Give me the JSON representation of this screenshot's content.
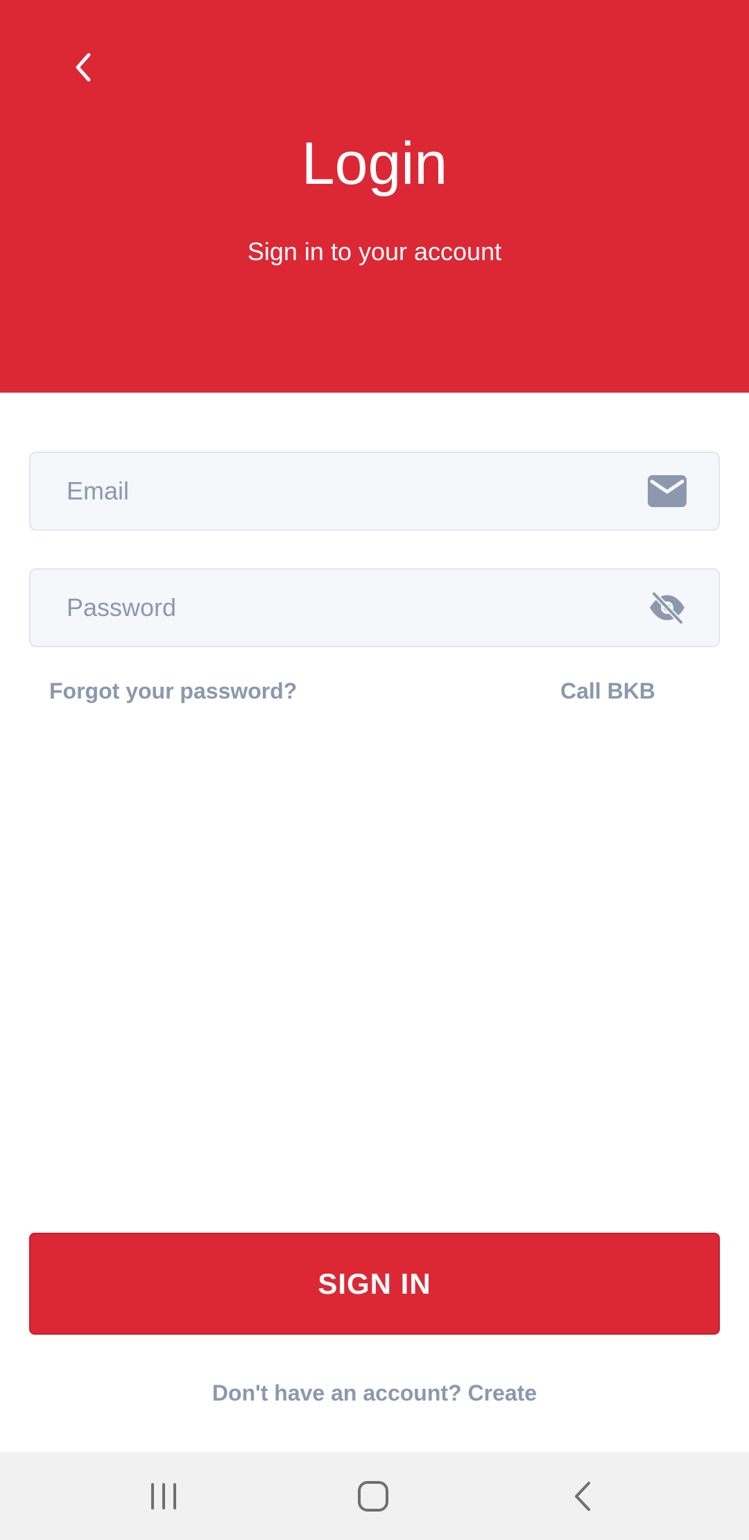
{
  "header": {
    "back_icon": "chevron-left-icon",
    "title": "Login",
    "subtitle": "Sign in to your account",
    "background_color": "#dc2735"
  },
  "form": {
    "email": {
      "placeholder": "Email",
      "value": "",
      "icon": "envelope-icon"
    },
    "password": {
      "placeholder": "Password",
      "value": "",
      "icon": "eye-off-icon"
    },
    "forgot_password_label": "Forgot your password?",
    "call_label": "Call BKB"
  },
  "actions": {
    "sign_in_label": "SIGN IN",
    "create_account_label": "Don't have an account? Create"
  },
  "system_nav": {
    "recents_icon": "recent-apps-icon",
    "home_icon": "home-icon",
    "back_icon": "back-icon"
  },
  "colors": {
    "accent": "#dc2735",
    "muted_text": "#8c98ad",
    "field_background": "#f5f7fb"
  }
}
